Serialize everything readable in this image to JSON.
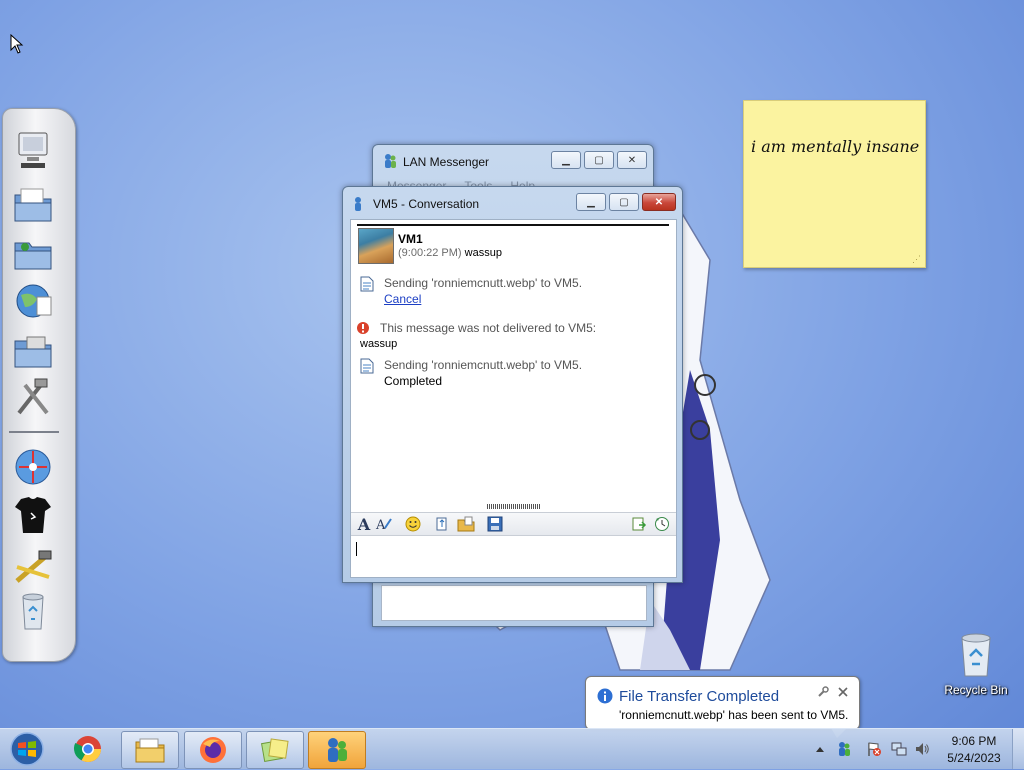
{
  "sticky_note": {
    "text": "i am mentally insane"
  },
  "lan_messenger": {
    "title": "LAN Messenger",
    "menu": [
      "Messenger",
      "Tools",
      "Help"
    ]
  },
  "conversation": {
    "title": "VM5 - Conversation",
    "contact_name": "VM1",
    "message_time": "(9:00:22 PM)",
    "message_text": "wassup",
    "entries": {
      "transfer1": "Sending 'ronniemcnutt.webp' to VM5.",
      "cancel": "Cancel",
      "error": "This message was not delivered to VM5:",
      "error_body": "wassup",
      "transfer2": "Sending 'ronniemcnutt.webp' to VM5.",
      "completed": "Completed"
    }
  },
  "desktop": {
    "recycle_bin_label": "Recycle Bin"
  },
  "notification": {
    "title": "File Transfer Completed",
    "body": "'ronniemcnutt.webp' has been sent to VM5."
  },
  "taskbar": {
    "pinned": [
      "start",
      "chrome",
      "file-explorer",
      "firefox",
      "sticky-notes",
      "lan-messenger"
    ],
    "clock_time": "9:06 PM",
    "clock_date": "5/24/2023"
  },
  "colors": {
    "desktop": "#7fa2e4",
    "sticky": "#fbf3a0",
    "link": "#1c3fc4",
    "balloon_title": "#1e4b9b",
    "close_button": "#c9473a"
  }
}
